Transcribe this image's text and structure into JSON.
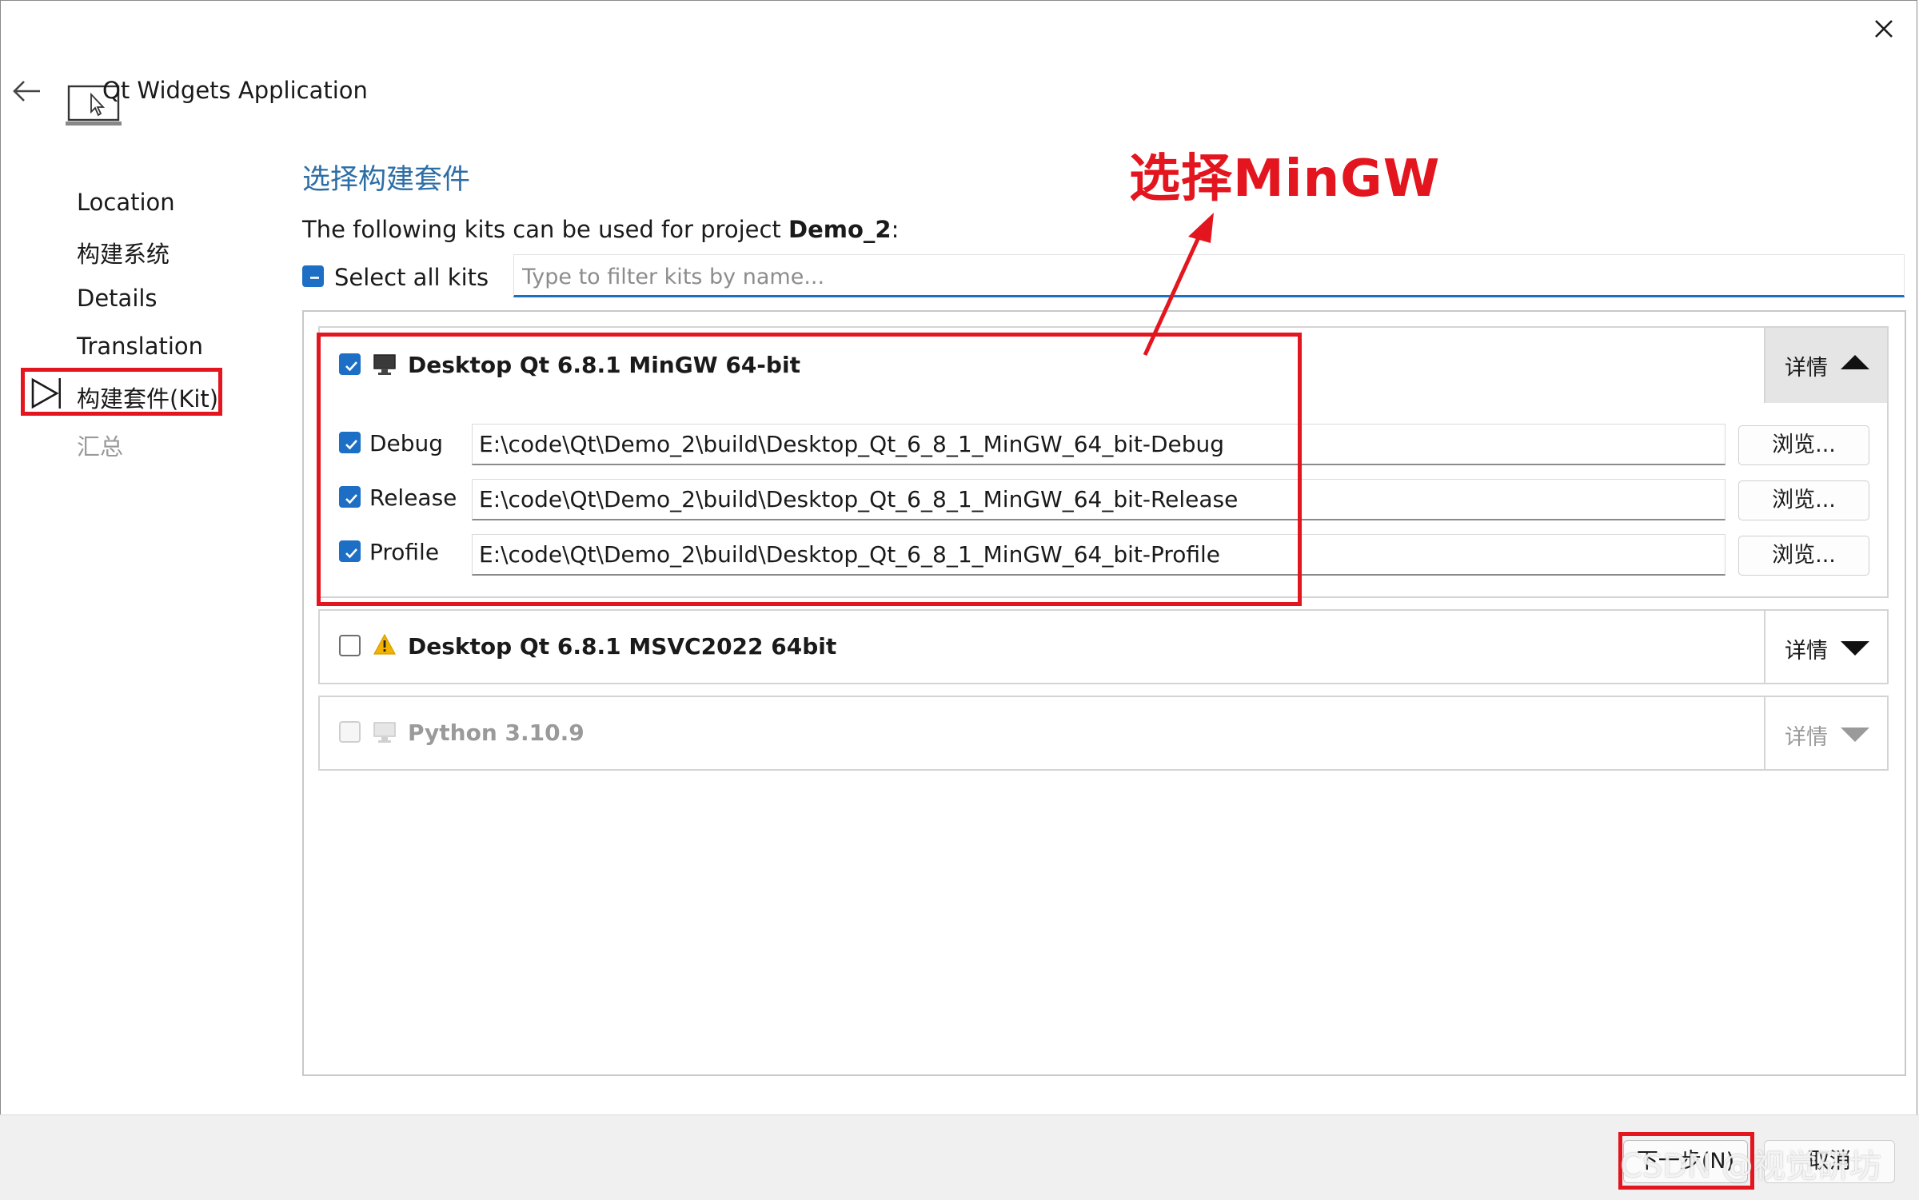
{
  "header": {
    "title": "Qt Widgets Application"
  },
  "sidebar": {
    "items": [
      {
        "label": "Location"
      },
      {
        "label": "构建系统"
      },
      {
        "label": "Details"
      },
      {
        "label": "Translation"
      },
      {
        "label": "构建套件(Kit)",
        "current": true
      },
      {
        "label": "汇总",
        "disabled": true
      }
    ]
  },
  "main": {
    "title": "选择构建套件",
    "intro_prefix": "The following kits can be used for project ",
    "project_name": "Demo_2",
    "intro_suffix": ":",
    "select_all_label": "Select all kits",
    "filter_placeholder": "Type to filter kits by name...",
    "browse_label": "浏览...",
    "details_label": "详情",
    "kits": [
      {
        "name": "Desktop Qt 6.8.1 MinGW 64-bit",
        "checked": true,
        "expanded": true,
        "configs": [
          {
            "label": "Debug",
            "checked": true,
            "path": "E:\\code\\Qt\\Demo_2\\build\\Desktop_Qt_6_8_1_MinGW_64_bit-Debug"
          },
          {
            "label": "Release",
            "checked": true,
            "path": "E:\\code\\Qt\\Demo_2\\build\\Desktop_Qt_6_8_1_MinGW_64_bit-Release"
          },
          {
            "label": "Profile",
            "checked": true,
            "path": "E:\\code\\Qt\\Demo_2\\build\\Desktop_Qt_6_8_1_MinGW_64_bit-Profile"
          }
        ]
      },
      {
        "name": "Desktop Qt 6.8.1 MSVC2022 64bit",
        "checked": false,
        "warning": true
      },
      {
        "name": "Python 3.10.9",
        "checked": false,
        "disabled": true
      }
    ]
  },
  "annotation": {
    "text": "选择MinGW",
    "color": "#e3161f"
  },
  "footer": {
    "next_label": "下一步(N)",
    "cancel_label": "取消"
  },
  "watermark": "CSDN @视觉研坊",
  "colors": {
    "accent": "#1c6fc4",
    "annotation_red": "#e3161f",
    "title_blue": "#2e6ea6"
  }
}
